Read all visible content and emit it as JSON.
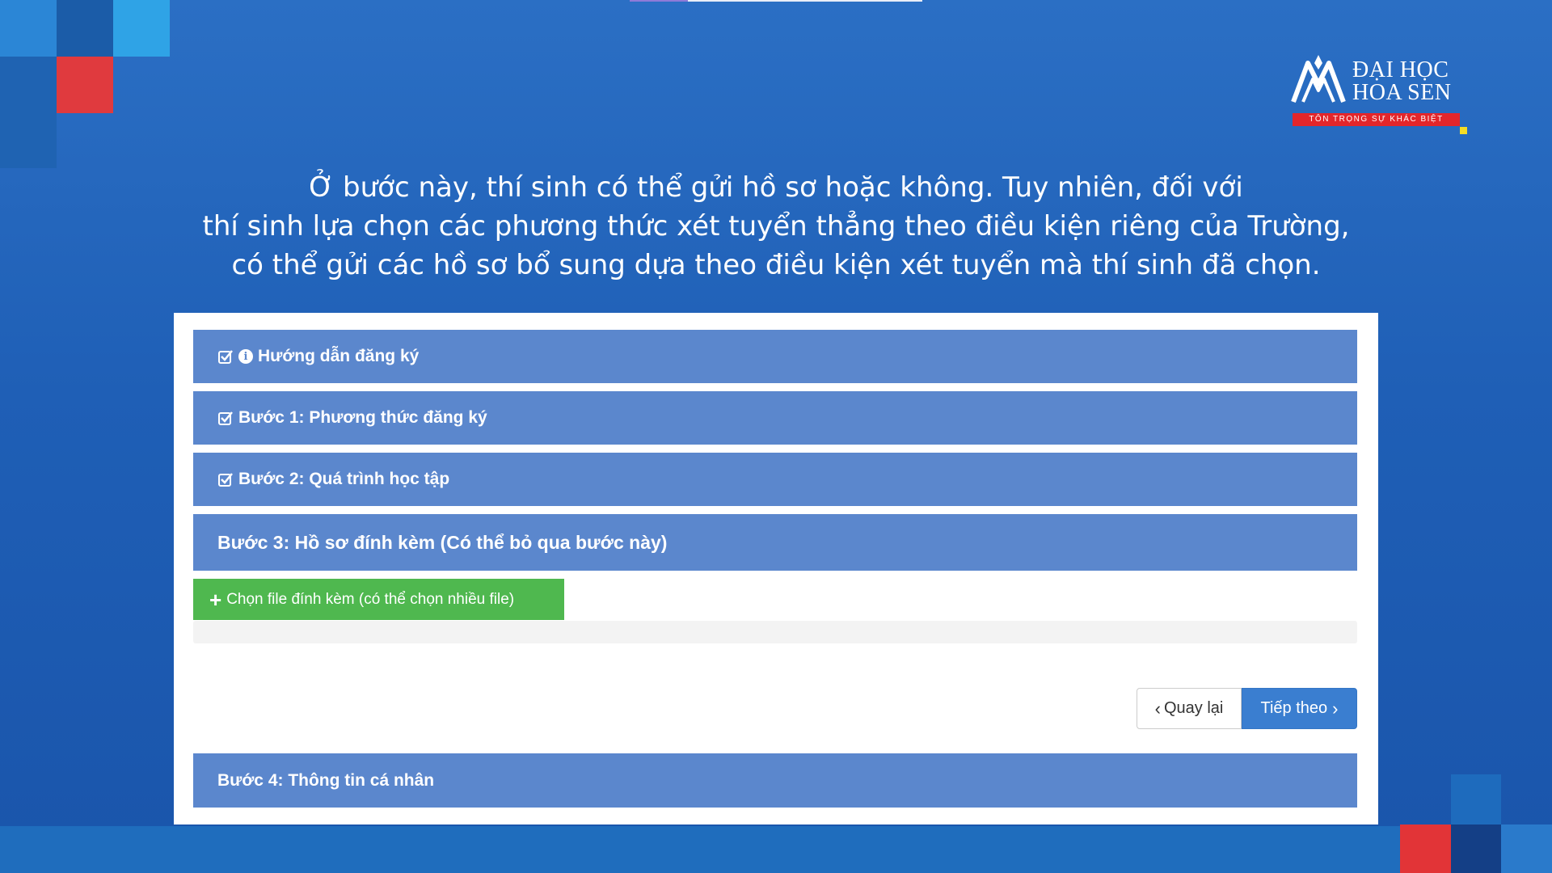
{
  "logo": {
    "line1": "ĐẠI HỌC",
    "line2": "HOA SEN",
    "tagline": "TÔN TRỌNG SỰ KHÁC BIỆT"
  },
  "caption": {
    "line1": "Ở bước này, thí sinh có thể gửi hồ sơ hoặc không. Tuy nhiên, đối với",
    "line2": "thí sinh lựa chọn các phương thức xét tuyển thẳng theo điều kiện riêng của Trường,",
    "line3": "có thể gửi các hồ sơ bổ sung dựa theo điều kiện xét tuyển mà thí sinh đã chọn."
  },
  "steps": {
    "guide": "Hướng dẫn đăng ký",
    "step1": "Bước 1: Phương thức đăng ký",
    "step2": "Bước 2: Quá trình học tập",
    "step3": "Bước 3: Hồ sơ đính kèm (Có thể bỏ qua bước này)",
    "step4": "Bước 4: Thông tin cá nhân"
  },
  "upload": {
    "label": "Chọn file đính kèm (có thể chọn nhiều file)"
  },
  "nav": {
    "back_label": "Quay lại",
    "next_label": "Tiếp theo"
  },
  "colors": {
    "panel": "#5b87cd",
    "upload_button": "#4fb84f",
    "next_button": "#3a7ed0",
    "accent_red": "#e3262b"
  }
}
